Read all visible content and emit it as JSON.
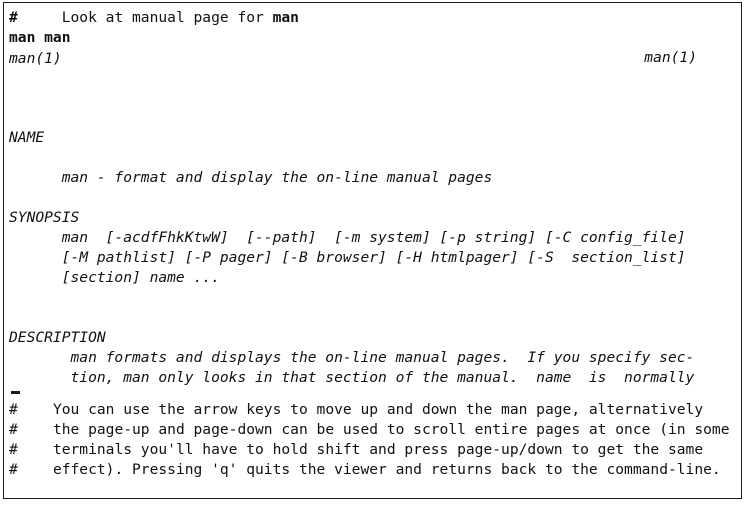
{
  "terminal": {
    "prompt_comment_line": {
      "marker": "#",
      "text": "     Look at manual page for ",
      "emphasis": "man"
    },
    "command": "man man",
    "man_header": {
      "left": "man(1)",
      "right": "man(1)"
    },
    "sections": [
      {
        "heading": "NAME",
        "lines": [
          "      man - format and display the on-line manual pages"
        ]
      },
      {
        "heading": "SYNOPSIS",
        "lines": [
          "      man  [-acdfFhkKtwW]  [--path]  [-m system] [-p string] [-C config_file]",
          "      [-M pathlist] [-P pager] [-B browser] [-H htmlpager] [-S  section_list]",
          "      [section] name ..."
        ]
      },
      {
        "heading": "DESCRIPTION",
        "lines": [
          "       man formats and displays the on-line manual pages.  If you specify sec-",
          "       tion, man only looks in that section of the manual.  name  is  normally"
        ]
      }
    ],
    "trailing_comments": [
      {
        "marker": "#",
        "text": "    You can use the arrow keys to move up and down the man page, alternatively"
      },
      {
        "marker": "#",
        "text": "    the page-up and page-down can be used to scroll entire pages at once (in some"
      },
      {
        "marker": "#",
        "text": "    terminals you'll have to hold shift and press page-up/down to get the same"
      },
      {
        "marker": "#",
        "text": "    effect). Pressing 'q' quits the viewer and returns back to the command-line."
      }
    ],
    "colors": {
      "background": "#ffffff",
      "text": "#111111",
      "border": "#1a1a1a"
    }
  }
}
